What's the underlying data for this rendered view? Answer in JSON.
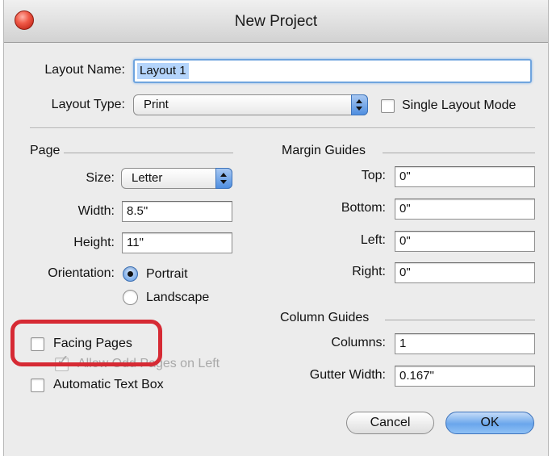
{
  "window": {
    "title": "New Project"
  },
  "layout": {
    "name_label": "Layout Name:",
    "name_value": "Layout 1",
    "type_label": "Layout Type:",
    "type_value": "Print",
    "single_mode_label": "Single Layout Mode",
    "single_mode_checked": false
  },
  "page": {
    "section_label": "Page",
    "size_label": "Size:",
    "size_value": "Letter",
    "width_label": "Width:",
    "width_value": "8.5\"",
    "height_label": "Height:",
    "height_value": "11\"",
    "orientation_label": "Orientation:",
    "orientation_options": [
      "Portrait",
      "Landscape"
    ],
    "orientation_selected": "Portrait"
  },
  "options": {
    "facing_pages_label": "Facing Pages",
    "facing_pages_checked": false,
    "allow_odd_label": "Allow Odd Pages on Left",
    "allow_odd_checked": true,
    "automatic_text_box_label": "Automatic Text Box",
    "automatic_text_box_checked": false
  },
  "margin_guides": {
    "section_label": "Margin Guides",
    "top_label": "Top:",
    "top_value": "0\"",
    "bottom_label": "Bottom:",
    "bottom_value": "0\"",
    "left_label": "Left:",
    "left_value": "0\"",
    "right_label": "Right:",
    "right_value": "0\""
  },
  "column_guides": {
    "section_label": "Column Guides",
    "columns_label": "Columns:",
    "columns_value": "1",
    "gutter_label": "Gutter Width:",
    "gutter_value": "0.167\""
  },
  "buttons": {
    "cancel": "Cancel",
    "ok": "OK"
  },
  "colors": {
    "accent": "#5f9be6",
    "highlight_ring": "#d62a34",
    "window_bg": "#ececec"
  },
  "icons": {
    "close": "close-icon",
    "popup_arrows": "chevron-updown-icon",
    "check": "check-icon"
  }
}
